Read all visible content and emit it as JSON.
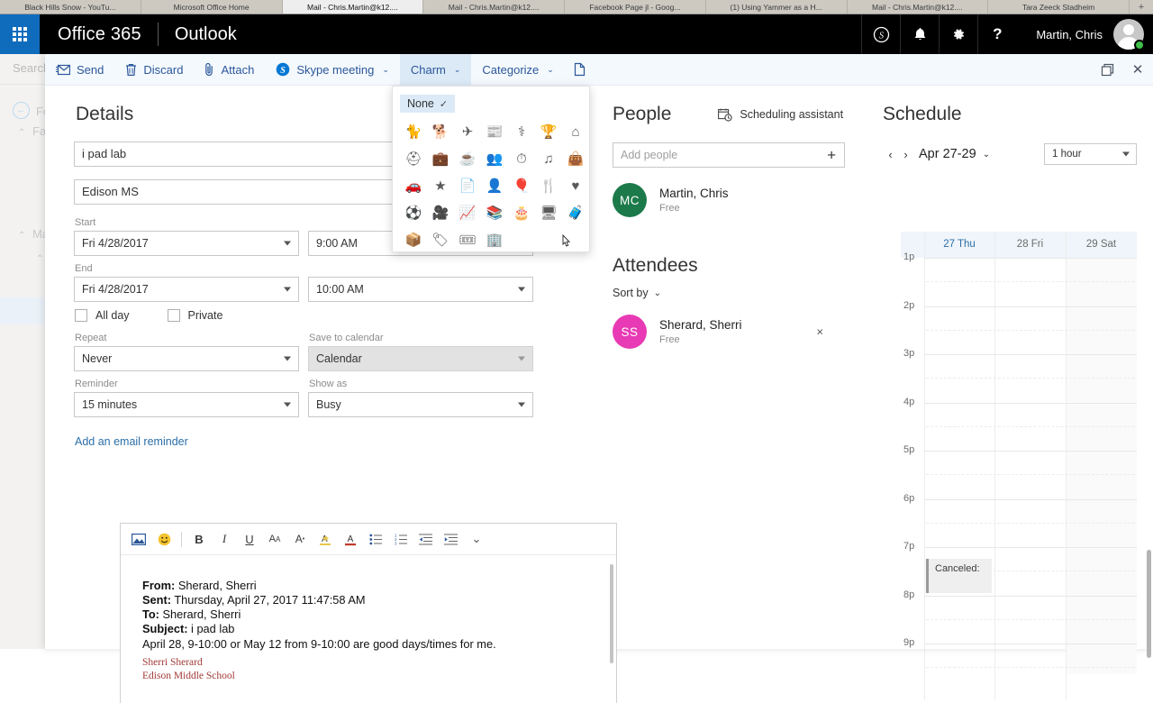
{
  "browser": {
    "tabs": [
      {
        "title": "Black Hills Snow - YouTu...",
        "active": false
      },
      {
        "title": "Microsoft Office Home",
        "active": false
      },
      {
        "title": "Mail - Chris.Martin@k12....",
        "active": true
      },
      {
        "title": "Mail - Chris.Martin@k12....",
        "active": false
      },
      {
        "title": "Facebook Page jl - Goog...",
        "active": false
      },
      {
        "title": "(1) Using Yammer as a H...",
        "active": false
      },
      {
        "title": "Mail - Chris.Martin@k12....",
        "active": false
      },
      {
        "title": "Tara Zeeck Stadheim",
        "active": false
      }
    ],
    "new_tab_label": "+"
  },
  "suiteBar": {
    "waffle_label": "app-launcher",
    "brand": "Office 365",
    "app": "Outlook",
    "icons": [
      {
        "name": "skype-icon",
        "glyph": "S"
      },
      {
        "name": "notifications-bell-icon",
        "glyph": "⚑"
      },
      {
        "name": "settings-gear-icon",
        "glyph": "⚙"
      },
      {
        "name": "help-question-icon",
        "glyph": "?"
      }
    ],
    "user_name": "Martin, Chris",
    "presence_color": "#3fbf4a",
    "accent_color": "#0f6cbd"
  },
  "background": {
    "search_placeholder": "Search",
    "back_label": "Fo",
    "favorites_label": "Fav",
    "mail_label": "Ma"
  },
  "toolbar": {
    "send_label": "Send",
    "discard_label": "Discard",
    "attach_label": "Attach",
    "skype_label": "Skype meeting",
    "charm_label": "Charm",
    "categorize_label": "Categorize",
    "caret": "⌄",
    "window_popout_label": "pop-out",
    "window_close_label": "✕"
  },
  "charmFlyout": {
    "none_label": "None",
    "none_check": "✓",
    "icons": [
      {
        "name": "charm-cat-icon",
        "glyph": "🐈"
      },
      {
        "name": "charm-dog-icon",
        "glyph": "🐕"
      },
      {
        "name": "charm-airplane-icon",
        "glyph": "✈"
      },
      {
        "name": "charm-news-icon",
        "glyph": "📰"
      },
      {
        "name": "charm-medical-kit-icon",
        "glyph": "⚕"
      },
      {
        "name": "charm-trophy-icon",
        "glyph": "🏆"
      },
      {
        "name": "charm-home-icon",
        "glyph": "⌂"
      },
      {
        "name": "charm-pill-icon",
        "glyph": "⛑"
      },
      {
        "name": "charm-briefcase-icon",
        "glyph": "💼"
      },
      {
        "name": "charm-coffee-icon",
        "glyph": "☕"
      },
      {
        "name": "charm-people-icon",
        "glyph": "👥"
      },
      {
        "name": "charm-stopwatch-icon",
        "glyph": "⏱"
      },
      {
        "name": "charm-music-note-icon",
        "glyph": "♫"
      },
      {
        "name": "charm-shopping-bag-icon",
        "glyph": "👜"
      },
      {
        "name": "charm-car-icon",
        "glyph": "🚗"
      },
      {
        "name": "charm-star-icon",
        "glyph": "★"
      },
      {
        "name": "charm-note-icon",
        "glyph": "📄"
      },
      {
        "name": "charm-person-icon",
        "glyph": "👤"
      },
      {
        "name": "charm-balloons-icon",
        "glyph": "🎈"
      },
      {
        "name": "charm-restaurant-icon",
        "glyph": "🍴"
      },
      {
        "name": "charm-heart-icon",
        "glyph": "♥"
      },
      {
        "name": "charm-soccer-ball-icon",
        "glyph": "⚽"
      },
      {
        "name": "charm-movie-camera-icon",
        "glyph": "🎥"
      },
      {
        "name": "charm-chart-icon",
        "glyph": "📈"
      },
      {
        "name": "charm-books-icon",
        "glyph": "📚"
      },
      {
        "name": "charm-birthday-cake-icon",
        "glyph": "🎂"
      },
      {
        "name": "charm-monitor-icon",
        "glyph": "🖥"
      },
      {
        "name": "charm-suitcase-icon",
        "glyph": "🧳"
      },
      {
        "name": "charm-box-icon",
        "glyph": "📦"
      },
      {
        "name": "charm-tag-icon",
        "glyph": "🏷"
      },
      {
        "name": "charm-ticket-icon",
        "glyph": "🎟"
      },
      {
        "name": "charm-building-icon",
        "glyph": "🏢"
      }
    ]
  },
  "details": {
    "heading": "Details",
    "title_value": "i pad lab",
    "location_value": "Edison MS",
    "start_label": "Start",
    "start_date": "Fri 4/28/2017",
    "start_time": "9:00 AM",
    "end_label": "End",
    "end_date": "Fri 4/28/2017",
    "end_time": "10:00 AM",
    "allday_label": "All day",
    "private_label": "Private",
    "repeat_label": "Repeat",
    "repeat_value": "Never",
    "save_to_calendar_label": "Save to calendar",
    "save_to_calendar_value": "Calendar",
    "reminder_label": "Reminder",
    "reminder_value": "15 minutes",
    "show_as_label": "Show as",
    "show_as_value": "Busy",
    "email_reminder_link": "Add an email reminder"
  },
  "editor": {
    "tools": [
      {
        "name": "insert-picture-icon",
        "glyph": "🏞"
      },
      {
        "name": "emoji-icon",
        "glyph": "☺"
      },
      {
        "name": "bold-icon",
        "glyph": "B"
      },
      {
        "name": "italic-icon",
        "glyph": "I"
      },
      {
        "name": "underline-icon",
        "glyph": "U"
      },
      {
        "name": "font-size-icon",
        "glyph": "Aᴀ"
      },
      {
        "name": "font-grow-icon",
        "glyph": "A˙"
      },
      {
        "name": "highlight-icon",
        "glyph": "A̲"
      },
      {
        "name": "font-color-icon",
        "glyph": "A"
      },
      {
        "name": "bulleted-list-icon",
        "glyph": "☰"
      },
      {
        "name": "numbered-list-icon",
        "glyph": "☰"
      },
      {
        "name": "decrease-indent-icon",
        "glyph": "⇤"
      },
      {
        "name": "increase-indent-icon",
        "glyph": "⇥"
      },
      {
        "name": "more-formatting-icon",
        "glyph": "⌄"
      }
    ],
    "body": {
      "from_label": "From:",
      "from_value": "Sherard, Sherri",
      "sent_label": "Sent:",
      "sent_value": "Thursday, April 27, 2017 11:47:58 AM",
      "to_label": "To:",
      "to_value": "Sherard, Sherri",
      "subject_label": "Subject:",
      "subject_value": "i pad lab",
      "message": "April 28, 9-10:00 or May 12 from 9-10:00 are good days/times for me.",
      "signature_name": "Sherri Sherard",
      "signature_org": "Edison Middle School"
    }
  },
  "people": {
    "heading": "People",
    "scheduling_assistant_label": "Scheduling assistant",
    "add_people_placeholder": "Add people",
    "add_button_glyph": "+",
    "organizer": {
      "initials": "MC",
      "name": "Martin, Chris",
      "status": "Free",
      "color": "#1c7a4a"
    },
    "attendees_heading": "Attendees",
    "sort_by_label": "Sort by",
    "sort_caret": "⌄",
    "attendees": [
      {
        "initials": "SS",
        "name": "Sherard, Sherri",
        "status": "Free",
        "color": "#e83ab4",
        "remove_glyph": "×"
      }
    ]
  },
  "schedule": {
    "heading": "Schedule",
    "prev_glyph": "‹",
    "next_glyph": "›",
    "range_label": "Apr 27-29",
    "range_caret": "⌄",
    "duration_value": "1 hour",
    "days": [
      {
        "label": "27 Thu",
        "today": true
      },
      {
        "label": "28 Fri",
        "today": false
      },
      {
        "label": "29 Sat",
        "today": false
      }
    ],
    "hours": [
      "1p",
      "2p",
      "3p",
      "4p",
      "5p",
      "6p",
      "7p",
      "8p",
      "9p"
    ],
    "events": [
      {
        "title": "Canceled:",
        "day": "27 Thu",
        "start": "7:30p"
      }
    ]
  }
}
